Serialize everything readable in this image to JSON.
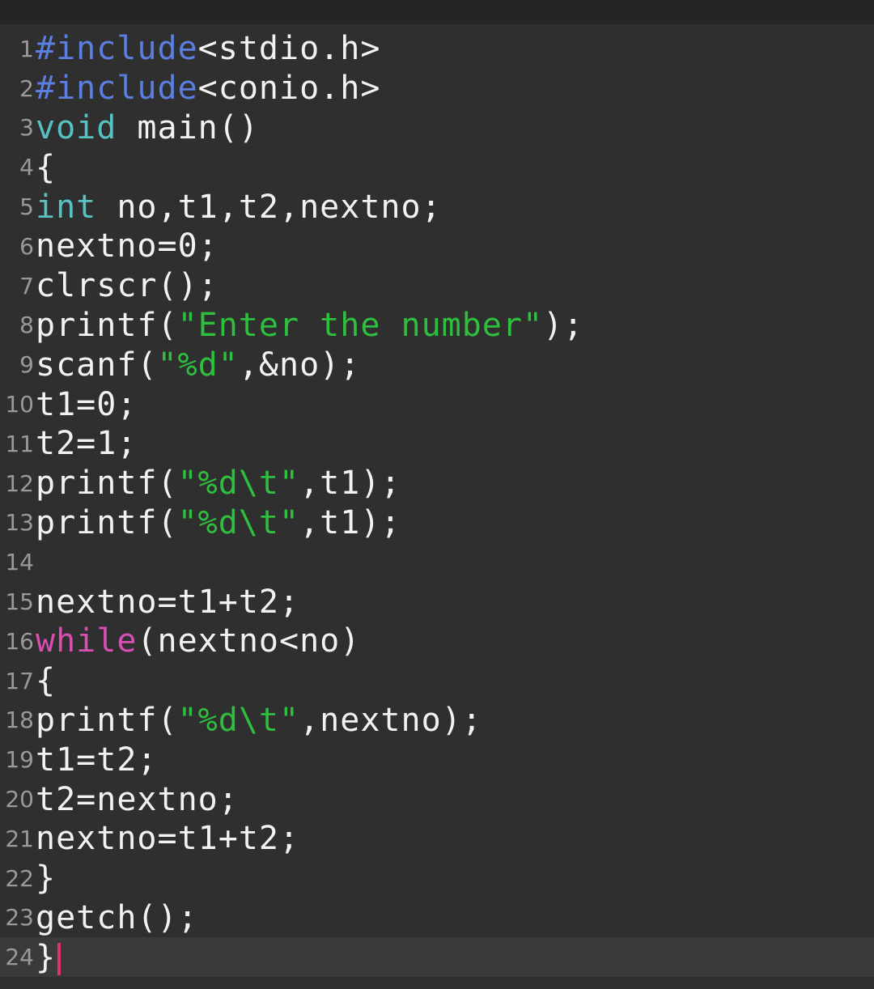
{
  "colors": {
    "background": "#2f2f2f",
    "preprocessor": "#5a7fe0",
    "type": "#55c3c3",
    "string": "#2fbf3f",
    "keyword": "#d84fb1",
    "text": "#f2f2f2",
    "line_number": "#9a9a9a",
    "cursor": "#e0316f"
  },
  "editor": {
    "current_line": 24,
    "lines": [
      {
        "num": "1",
        "tokens": [
          {
            "t": "pre",
            "v": "#include"
          },
          {
            "t": "plain",
            "v": "<stdio.h>"
          }
        ]
      },
      {
        "num": "2",
        "tokens": [
          {
            "t": "pre",
            "v": "#include"
          },
          {
            "t": "plain",
            "v": "<conio.h>"
          }
        ]
      },
      {
        "num": "3",
        "tokens": [
          {
            "t": "type",
            "v": "void"
          },
          {
            "t": "plain",
            "v": " main()"
          }
        ]
      },
      {
        "num": "4",
        "tokens": [
          {
            "t": "plain",
            "v": "{"
          }
        ]
      },
      {
        "num": "5",
        "tokens": [
          {
            "t": "type",
            "v": "int"
          },
          {
            "t": "plain",
            "v": " no,t1,t2,nextno;"
          }
        ]
      },
      {
        "num": "6",
        "tokens": [
          {
            "t": "plain",
            "v": "nextno=0;"
          }
        ]
      },
      {
        "num": "7",
        "tokens": [
          {
            "t": "plain",
            "v": "clrscr();"
          }
        ]
      },
      {
        "num": "8",
        "tokens": [
          {
            "t": "plain",
            "v": "printf("
          },
          {
            "t": "str",
            "v": "\"Enter the number\""
          },
          {
            "t": "plain",
            "v": ");"
          }
        ]
      },
      {
        "num": "9",
        "tokens": [
          {
            "t": "plain",
            "v": "scanf("
          },
          {
            "t": "str",
            "v": "\"%d\""
          },
          {
            "t": "plain",
            "v": ",&no);"
          }
        ]
      },
      {
        "num": "10",
        "tokens": [
          {
            "t": "plain",
            "v": "t1=0;"
          }
        ]
      },
      {
        "num": "11",
        "tokens": [
          {
            "t": "plain",
            "v": "t2=1;"
          }
        ]
      },
      {
        "num": "12",
        "tokens": [
          {
            "t": "plain",
            "v": "printf("
          },
          {
            "t": "str",
            "v": "\"%d\\t\""
          },
          {
            "t": "plain",
            "v": ",t1);"
          }
        ]
      },
      {
        "num": "13",
        "tokens": [
          {
            "t": "plain",
            "v": "printf("
          },
          {
            "t": "str",
            "v": "\"%d\\t\""
          },
          {
            "t": "plain",
            "v": ",t1);"
          }
        ]
      },
      {
        "num": "14",
        "tokens": []
      },
      {
        "num": "15",
        "tokens": [
          {
            "t": "plain",
            "v": "nextno=t1+t2;"
          }
        ]
      },
      {
        "num": "16",
        "tokens": [
          {
            "t": "kw",
            "v": "while"
          },
          {
            "t": "plain",
            "v": "(nextno<no)"
          }
        ]
      },
      {
        "num": "17",
        "tokens": [
          {
            "t": "plain",
            "v": "{"
          }
        ]
      },
      {
        "num": "18",
        "tokens": [
          {
            "t": "plain",
            "v": "printf("
          },
          {
            "t": "str",
            "v": "\"%d\\t\""
          },
          {
            "t": "plain",
            "v": ",nextno);"
          }
        ]
      },
      {
        "num": "19",
        "tokens": [
          {
            "t": "plain",
            "v": "t1=t2;"
          }
        ]
      },
      {
        "num": "20",
        "tokens": [
          {
            "t": "plain",
            "v": "t2=nextno;"
          }
        ]
      },
      {
        "num": "21",
        "tokens": [
          {
            "t": "plain",
            "v": "nextno=t1+t2;"
          }
        ]
      },
      {
        "num": "22",
        "tokens": [
          {
            "t": "plain",
            "v": "}"
          }
        ]
      },
      {
        "num": "23",
        "tokens": [
          {
            "t": "plain",
            "v": "getch();"
          }
        ]
      },
      {
        "num": "24",
        "tokens": [
          {
            "t": "plain",
            "v": "}"
          }
        ]
      }
    ]
  }
}
